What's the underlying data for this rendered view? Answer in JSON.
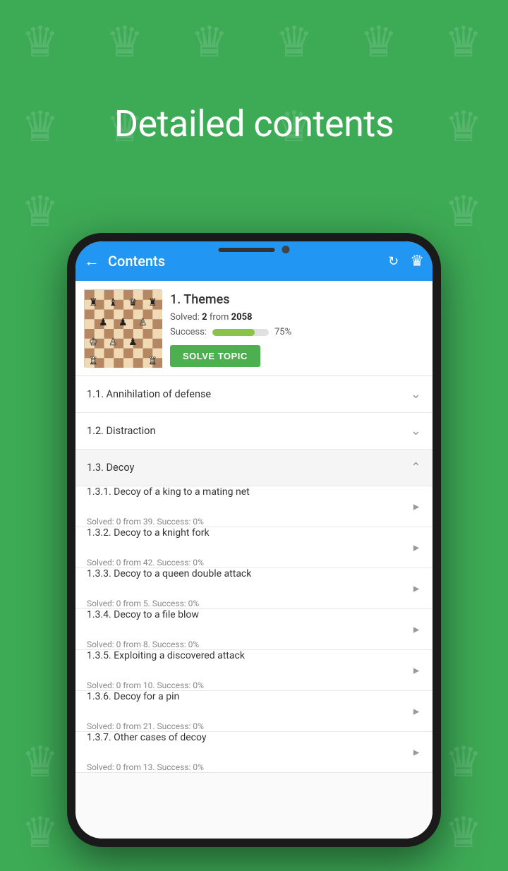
{
  "background": {
    "color": "#3daa56"
  },
  "headline": "Detailed contents",
  "phone": {
    "app_bar": {
      "title": "Contents",
      "back_icon": "←",
      "refresh_icon": "↻",
      "butterfly_icon": "♛"
    },
    "topic": {
      "title": "1. Themes",
      "solved_label": "Solved: ",
      "solved_count": "2",
      "solved_from": "from",
      "solved_total": "2058",
      "success_label": "Success:",
      "success_pct": "75%",
      "progress_pct": 75,
      "solve_button_label": "SOLVE TOPIC"
    },
    "list_items": [
      {
        "id": "1.1",
        "label": "1.1. Annihilation of defense",
        "type": "collapsed",
        "chevron": "∨"
      },
      {
        "id": "1.2",
        "label": "1.2. Distraction",
        "type": "collapsed",
        "chevron": "∨"
      },
      {
        "id": "1.3",
        "label": "1.3. Decoy",
        "type": "expanded",
        "chevron": "∧"
      },
      {
        "id": "1.3.1",
        "label": "1.3.1. Decoy of a king to a mating net",
        "sublabel": "Solved: 0 from 39. Success: 0%",
        "type": "sub"
      },
      {
        "id": "1.3.2",
        "label": "1.3.2. Decoy to a knight fork",
        "sublabel": "Solved: 0 from 42. Success: 0%",
        "type": "sub"
      },
      {
        "id": "1.3.3",
        "label": "1.3.3. Decoy to a queen double attack",
        "sublabel": "Solved: 0 from 5. Success: 0%",
        "type": "sub"
      },
      {
        "id": "1.3.4",
        "label": "1.3.4. Decoy to a file blow",
        "sublabel": "Solved: 0 from 8. Success: 0%",
        "type": "sub"
      },
      {
        "id": "1.3.5",
        "label": "1.3.5. Exploiting a discovered attack",
        "sublabel": "Solved: 0 from 10. Success: 0%",
        "type": "sub"
      },
      {
        "id": "1.3.6",
        "label": "1.3.6. Decoy for a pin",
        "sublabel": "Solved: 0 from 21. Success: 0%",
        "type": "sub"
      },
      {
        "id": "1.3.7",
        "label": "1.3.7. Other cases of decoy",
        "sublabel": "Solved: 0 from 13. Success: 0%",
        "type": "sub"
      }
    ]
  }
}
